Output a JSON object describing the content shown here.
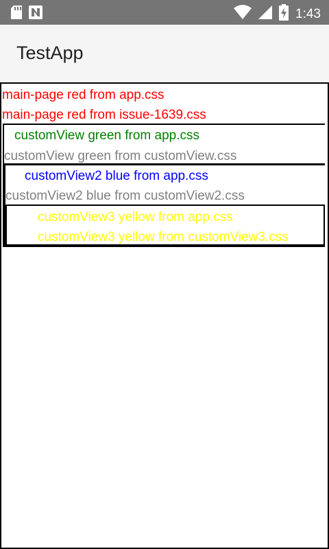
{
  "status_bar": {
    "time": "1:43",
    "icons": [
      "sd-card-icon",
      "nfc-icon",
      "wifi-icon",
      "cellular-icon",
      "battery-charging-icon"
    ]
  },
  "app_bar": {
    "title": "TestApp"
  },
  "main_page": {
    "line1": "main-page red from app.css",
    "line2": "main-page red from issue-1639.css",
    "color": "#ff0000"
  },
  "custom_view": {
    "line1": "customView green from app.css",
    "line2": "customView green from customView.css",
    "line1_color": "#008000",
    "line2_color": "#808080"
  },
  "custom_view2": {
    "line1": "customView2 blue from app.css",
    "line2": "customView2 blue from customView2.css",
    "line1_color": "#0000ff",
    "line2_color": "#808080"
  },
  "custom_view3": {
    "line1": "customView3 yellow from app.css",
    "line2": "customView3 yellow from customView3.css",
    "color": "#ffff00"
  }
}
